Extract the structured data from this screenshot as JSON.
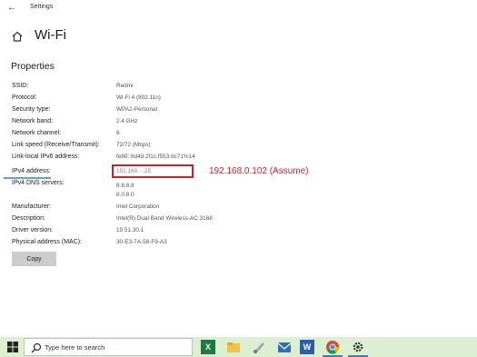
{
  "window": {
    "app_title": "Settings"
  },
  "header": {
    "title": "Wi-Fi"
  },
  "section": {
    "title": "Properties"
  },
  "properties": [
    {
      "label": "SSID:",
      "value": "Redmi"
    },
    {
      "label": "Protocol:",
      "value": "Wi-Fi 4 (802.11n)"
    },
    {
      "label": "Security type:",
      "value": "WPA2-Personal"
    },
    {
      "label": "Network band:",
      "value": "2.4 GHz"
    },
    {
      "label": "Network channel:",
      "value": "6"
    },
    {
      "label": "Link speed (Receive/Transmit):",
      "value": "72/72 (Mbps)"
    },
    {
      "label": "Link-local IPv6 address:",
      "value": "fe80::8d4d:2f1c:f553:dc71%14"
    },
    {
      "label": "IPv4 address:",
      "value": "192.168.··.25"
    },
    {
      "label": "IPv4 DNS servers:",
      "value": "8.8.8.8",
      "value2": "8.0.8.0"
    },
    {
      "label": "Manufacturer:",
      "value": "Intel Corporation"
    },
    {
      "label": "Description:",
      "value": "Intel(R) Dual Band Wireless-AC 3168"
    },
    {
      "label": "Driver version:",
      "value": "19.51.30.1"
    },
    {
      "label": "Physical address (MAC):",
      "value": "30-E3-7A-58-F9-A3"
    }
  ],
  "annotation": {
    "text": "192.168.0.102 (Assume)",
    "color": "#c0272d"
  },
  "copy_button": {
    "label": "Copy"
  },
  "taskbar": {
    "search_placeholder": "Type here to search",
    "icons": [
      "excel-icon",
      "file-explorer-icon",
      "paint-icon",
      "mail-icon",
      "word-icon",
      "chrome-icon",
      "settings-icon"
    ]
  }
}
